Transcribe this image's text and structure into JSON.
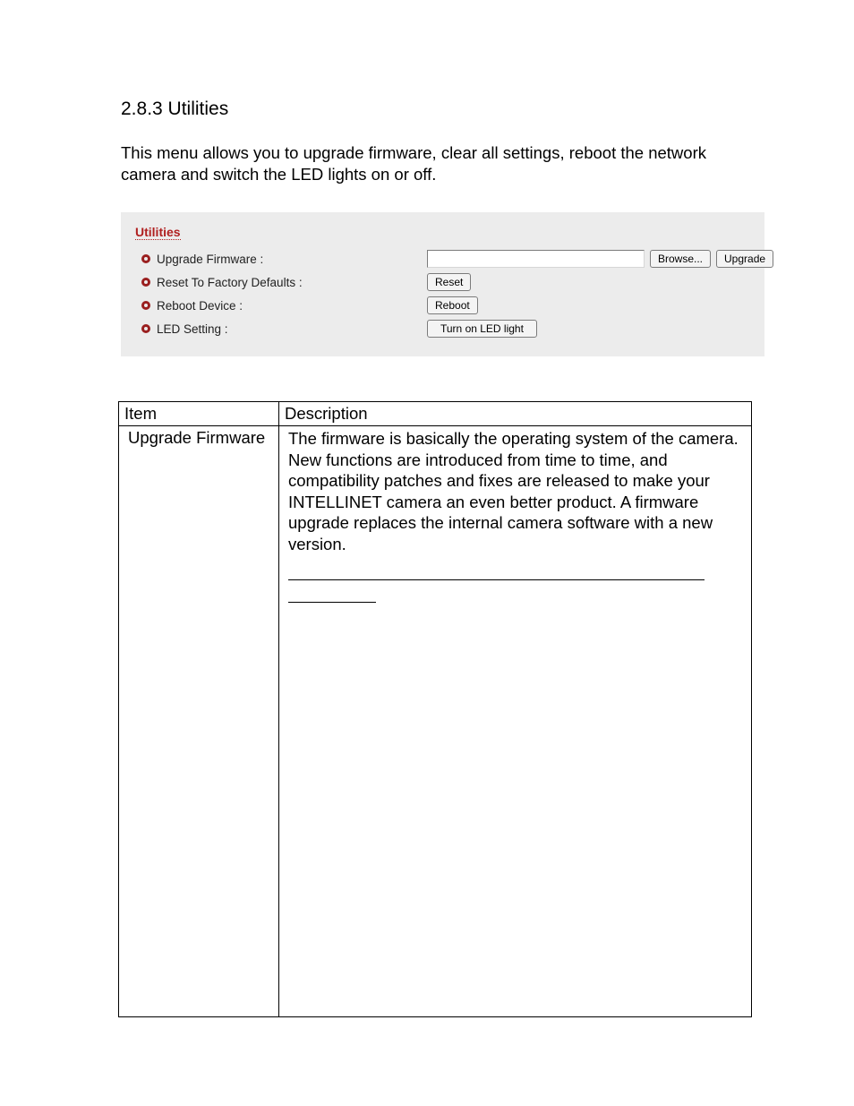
{
  "section": {
    "number_title": "2.8.3 Utilities",
    "intro": "This menu allows you to upgrade firmware, clear all settings, reboot the network camera and switch the LED lights on or off."
  },
  "panel": {
    "title": "Utilities",
    "rows": {
      "upgrade": {
        "label": "Upgrade Firmware :",
        "browse": "Browse...",
        "upgrade": "Upgrade"
      },
      "reset": {
        "label": "Reset To Factory Defaults :",
        "button": "Reset"
      },
      "reboot": {
        "label": "Reboot Device :",
        "button": "Reboot"
      },
      "led": {
        "label": "LED Setting :",
        "button": "Turn on LED light"
      }
    }
  },
  "table": {
    "head_item": "Item",
    "head_desc": "Description",
    "row1_item": "Upgrade Firmware",
    "row1_desc": "The firmware is basically the operating system of the camera. New functions are introduced from time to time, and compatibility patches and fixes are released to make your INTELLINET camera an even better product. A firmware upgrade replaces the internal camera software with a new version."
  }
}
